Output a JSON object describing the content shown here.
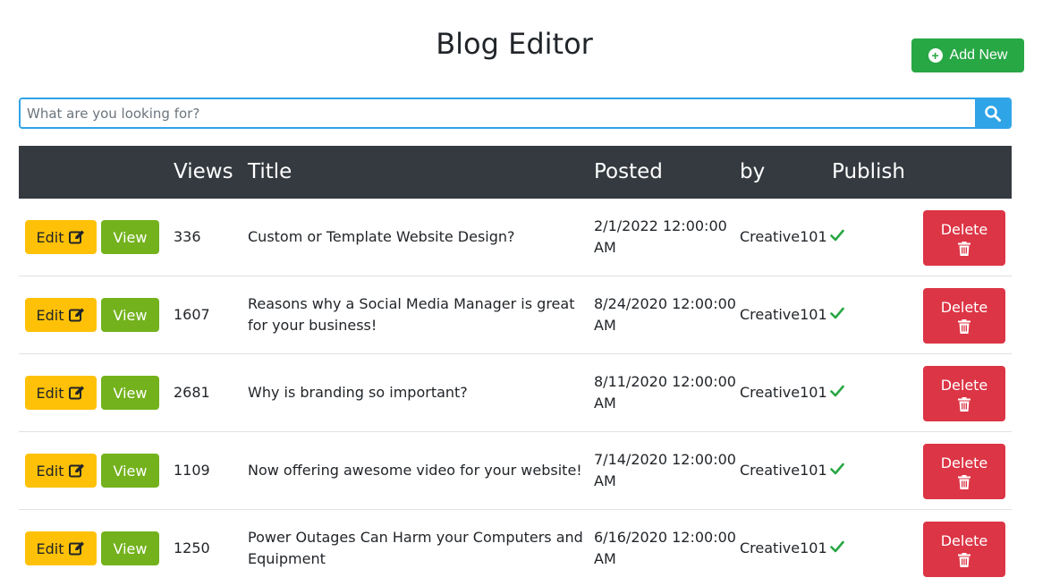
{
  "header": {
    "title": "Blog Editor",
    "add_new_label": "Add New"
  },
  "search": {
    "placeholder": "What are you looking for?",
    "value": ""
  },
  "table": {
    "columns": [
      "",
      "Views",
      "Title",
      "Posted",
      "by",
      "Publish",
      ""
    ],
    "edit_label": "Edit",
    "view_label": "View",
    "delete_label": "Delete",
    "rows": [
      {
        "views": "336",
        "title": "Custom or Template Website Design?",
        "posted": "2/1/2022 12:00:00 AM",
        "by": "Creative101",
        "published": true
      },
      {
        "views": "1607",
        "title": "Reasons why a Social Media Manager is great for your business!",
        "posted": "8/24/2020 12:00:00 AM",
        "by": "Creative101",
        "published": true
      },
      {
        "views": "2681",
        "title": "Why is branding so important?",
        "posted": "8/11/2020 12:00:00 AM",
        "by": "Creative101",
        "published": true
      },
      {
        "views": "1109",
        "title": "Now offering awesome video for your website!",
        "posted": "7/14/2020 12:00:00 AM",
        "by": "Creative101",
        "published": true
      },
      {
        "views": "1250",
        "title": "Power Outages Can Harm your Computers and Equipment",
        "posted": "6/16/2020 12:00:00 AM",
        "by": "Creative101",
        "published": true
      }
    ]
  },
  "colors": {
    "edit": "#ffc107",
    "view": "#73b21d",
    "delete": "#dc3545",
    "add_new": "#28a745",
    "search_accent": "#2fa4e7",
    "table_header": "#343a40"
  },
  "icons": {
    "add_new": "plus-circle-icon",
    "search": "search-icon",
    "edit": "edit-icon",
    "delete": "trash-icon",
    "publish": "check-icon"
  }
}
